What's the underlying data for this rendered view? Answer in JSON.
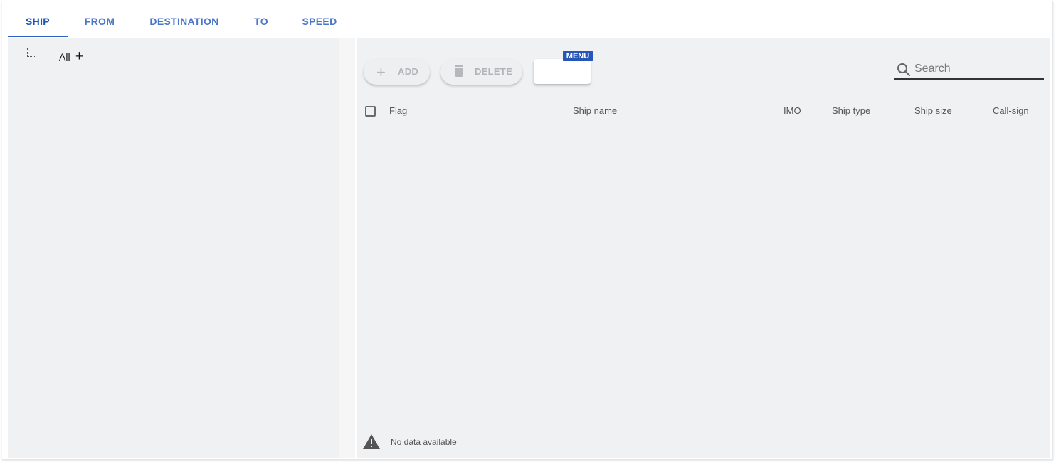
{
  "tabs": [
    {
      "label": "SHIP",
      "active": true
    },
    {
      "label": "FROM",
      "active": false
    },
    {
      "label": "DESTINATION",
      "active": false
    },
    {
      "label": "TO",
      "active": false
    },
    {
      "label": "SPEED",
      "active": false
    }
  ],
  "tree": {
    "root_label": "All",
    "add_symbol": "+"
  },
  "toolbar": {
    "add_label": "ADD",
    "add_icon": "plus-icon",
    "delete_label": "DELETE",
    "delete_icon": "trash-icon",
    "menu_badge": "MENU"
  },
  "search": {
    "placeholder": "Search",
    "value": "",
    "icon": "search-icon"
  },
  "table": {
    "columns": [
      "Flag",
      "Ship name",
      "IMO",
      "Ship type",
      "Ship size",
      "Call-sign"
    ],
    "rows": [],
    "empty_message": "No data available",
    "empty_icon": "warning-icon"
  },
  "colors": {
    "accent": "#2f61c0",
    "tab_text": "#4a76c9",
    "badge": "#2656b8",
    "pane_bg": "#f0f1f3"
  }
}
